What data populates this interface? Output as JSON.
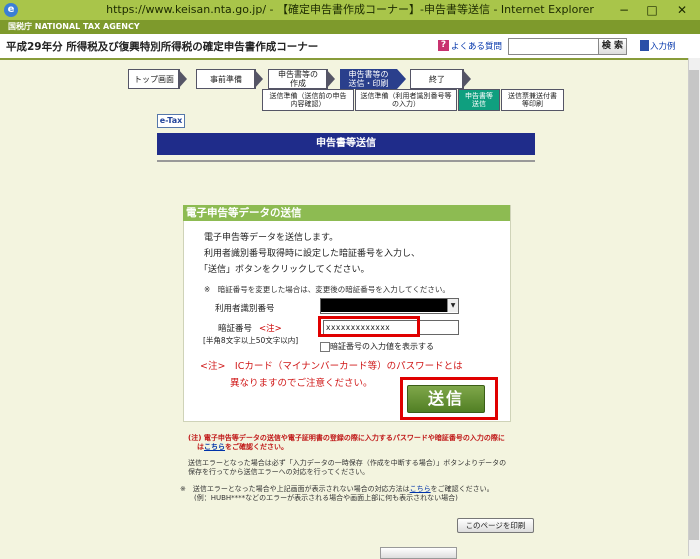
{
  "window": {
    "title": "https://www.keisan.nta.go.jp/ - 【確定申告書作成コーナー】-申告書等送信 - Internet Explorer",
    "minimize": "−",
    "maximize": "□",
    "close": "✕",
    "browser_icon": "e"
  },
  "agency": {
    "label": "国税庁 NATIONAL TAX AGENCY"
  },
  "header": {
    "title": "平成29年分 所得税及び復興特別所得税の確定申告書作成コーナー",
    "faq_icon": "?",
    "faq": "よくある質問",
    "search_placeholder": "",
    "search_button": "検 索",
    "help": "入力例"
  },
  "steps": {
    "main": [
      "トップ画面",
      "事前準備",
      "申告書等の\n作成",
      "申告書等の\n送信・印刷",
      "終了"
    ],
    "sub": [
      "送信準備（送信前の申告\n内容確認）",
      "送信準備（利用者識別番号等\nの入力）",
      "申告書等\n送信",
      "送信票兼送付書\n等印刷"
    ]
  },
  "etax": "e-Tax",
  "page_title": "申告書等送信",
  "panel": {
    "heading": "電子申告等データの送信",
    "line1": "電子申告等データを送信します。",
    "line2": "利用者識別番号取得時に設定した暗証番号を入力し、",
    "line3": "「送信」ボタンをクリックしてください。",
    "note": "※　暗証番号を変更した場合は、変更後の暗証番号を入力してください。",
    "userid_label": "利用者識別番号",
    "userid_drop": "▼",
    "pw_label": "暗証番号",
    "pw_note": "<注>",
    "pw_hint": "[半角8文字以上50文字以内]",
    "pw_value": "xxxxxxxxxxxxx",
    "show_pw": "暗証番号の入力値を表示する",
    "warn1": "<注>　ICカード（マイナンバーカード等）のパスワードとは",
    "warn2": "異なりますのでご注意ください。",
    "send": "送信"
  },
  "notes": {
    "red1": "(注) 電子申告等データの送信や電子証明書の登録の際に入力するパスワードや暗証番号の入力の際に",
    "red2a": "は",
    "red2link": "こちら",
    "red2b": "をご確認ください。",
    "e1": "送信エラーとなった場合は必ず「入力データの一時保存（作成を中断する場合）」ボタンよりデータの",
    "e2": "保存を行ってから送信エラーへの対応を行ってください。",
    "e3a": "※　送信エラーとなった場合や上記画面が表示されない場合の対応方法は",
    "e3link": "こちら",
    "e3b": "をご確認ください。",
    "e4": "(例：HUBH****などのエラーが表示される場合や画面上部に何も表示されない場合)"
  },
  "print_button": "このページを印刷",
  "colors": {
    "title_band": "#1f2c8a",
    "panel_head": "#8dbb52",
    "send_button": "#517f24",
    "highlight": "#e00000"
  }
}
